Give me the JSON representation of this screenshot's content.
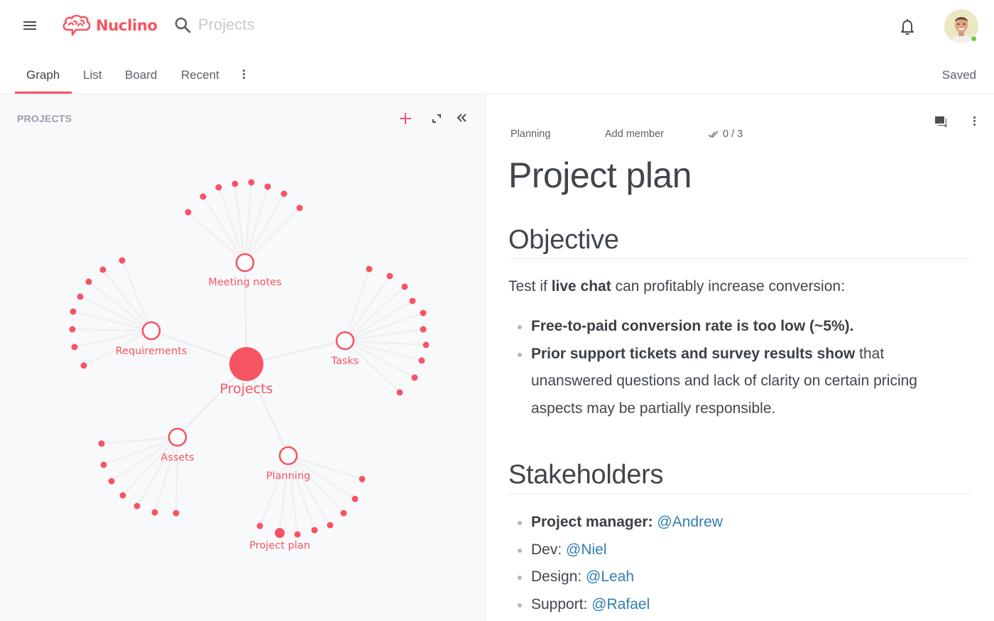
{
  "app": {
    "name": "Nuclino",
    "brand_color": "#f65462",
    "logo_icon": "brain-speech-bubble-icon"
  },
  "header": {
    "menu_icon": "hamburger-menu-icon",
    "search": {
      "placeholder": "Projects",
      "value": "",
      "icon": "search-icon"
    },
    "notifications_icon": "bell-icon",
    "user": {
      "avatar_icon": "user-avatar",
      "status": "online",
      "status_color": "#6ccb3d"
    }
  },
  "tabs": {
    "items": [
      {
        "label": "Graph",
        "active": true
      },
      {
        "label": "List",
        "active": false
      },
      {
        "label": "Board",
        "active": false
      },
      {
        "label": "Recent",
        "active": false
      }
    ],
    "more_icon": "more-vertical-icon",
    "status": "Saved"
  },
  "sidebar": {
    "title": "PROJECTS",
    "actions": {
      "add_icon": "plus-icon",
      "expand_icon": "expand-icon",
      "collapse_icon": "double-chevron-left-icon"
    },
    "graph": {
      "root": {
        "label": "Projects"
      },
      "clusters": [
        {
          "label": "Meeting notes",
          "item_count": 8
        },
        {
          "label": "Requirements",
          "item_count": 8
        },
        {
          "label": "Tasks",
          "item_count": 10
        },
        {
          "label": "Assets",
          "item_count": 7
        },
        {
          "label": "Planning",
          "item_count": 8,
          "highlighted_item": "Project plan"
        }
      ]
    }
  },
  "document": {
    "comments_icon": "comments-icon",
    "more_icon": "more-vertical-icon",
    "meta": {
      "cluster": "Planning",
      "add_member": "Add member",
      "tasks_icon": "double-check-icon",
      "tasks_progress": "0 / 3"
    },
    "title": "Project plan",
    "sections": {
      "objective": {
        "heading": "Objective",
        "intro": {
          "pre": "Test if ",
          "bold": "live chat",
          "post": " can profitably increase conversion:"
        },
        "bullets": [
          {
            "bold": "Free-to-paid conversion rate is too low (~5%).",
            "text": ""
          },
          {
            "bold": "Prior support tickets and survey results show",
            "text": " that unanswered questions and lack of clarity on certain pricing aspects may be partially responsible."
          }
        ]
      },
      "stakeholders": {
        "heading": "Stakeholders",
        "items": [
          {
            "role": "Project manager: ",
            "bold": true,
            "mention": "@Andrew"
          },
          {
            "role": "Dev: ",
            "bold": false,
            "mention": "@Niel"
          },
          {
            "role": "Design: ",
            "bold": false,
            "mention": "@Leah"
          },
          {
            "role": "Support: ",
            "bold": false,
            "mention": "@Rafael"
          }
        ]
      }
    },
    "mention_color": "#2e7fb0"
  }
}
